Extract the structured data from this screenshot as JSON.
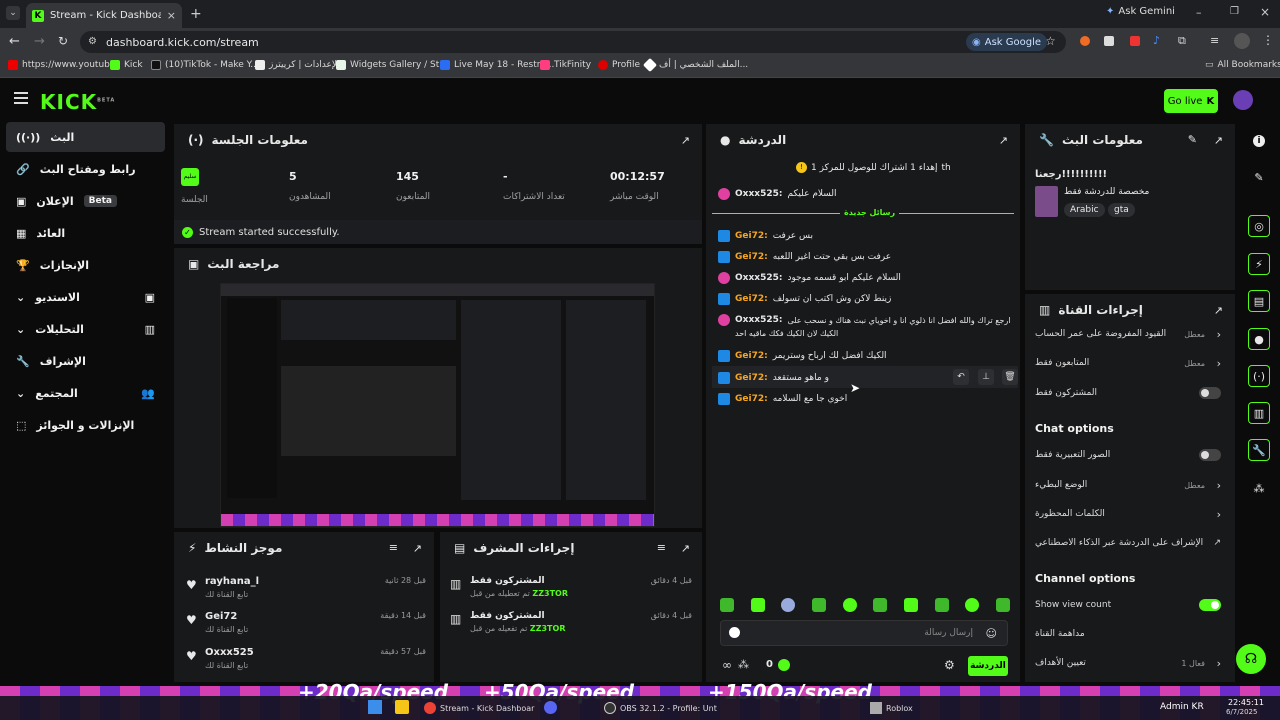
{
  "browser": {
    "tab_title": "Stream - Kick Dashboard",
    "ask_gemini": "Ask Gemini",
    "url": "dashboard.kick.com/stream",
    "ask_google": "Ask Google",
    "bookmarks": [
      "https://www.youtub...",
      "Kick",
      "(10)TikTok - Make Y...",
      "الإعدادات | كرييترز",
      "Widgets Gallery / St...",
      "Live May 18 - Restre...",
      "TikFinity",
      "Profile",
      "الملف الشخصي | أف..."
    ],
    "all_bookmarks": "All Bookmarks"
  },
  "kick": {
    "logo": "KICK",
    "beta": "BETA",
    "go_live": "Go live"
  },
  "sidebar": {
    "items": [
      {
        "label": "البث",
        "icon": "broadcast-icon"
      },
      {
        "label": "رابط ومفتاح البث",
        "icon": "link-icon"
      },
      {
        "label": "الإعلان",
        "icon": "ad-icon",
        "badge": "Beta"
      },
      {
        "label": "العائد",
        "icon": "chart-icon"
      },
      {
        "label": "الإنجازات",
        "icon": "trophy-icon"
      },
      {
        "label": "الاستديو",
        "icon": "studio-icon"
      },
      {
        "label": "التحليلات",
        "icon": "analytics-icon"
      },
      {
        "label": "الإشراف",
        "icon": "wrench-icon"
      },
      {
        "label": "المجتمع",
        "icon": "community-icon"
      },
      {
        "label": "الإنزالات و الجوائز",
        "icon": "drops-icon"
      }
    ]
  },
  "session": {
    "title": "معلومات الجلسة",
    "live_badge": "سليم",
    "live_label": "الجلسة",
    "viewers_value": "5",
    "viewers_label": "المشاهدون",
    "followers_value": "145",
    "followers_label": "المتابعون",
    "subs_value": "-",
    "subs_label": "تعداد الاشتراكات",
    "time_value": "00:12:57",
    "time_label": "الوقت مباشر",
    "status": "Stream started successfully."
  },
  "preview": {
    "title": "مراجعة البث"
  },
  "chat": {
    "title": "الدردشة",
    "goal": "إهداء 1 اشتراك للوصول للمركز 1",
    "goal_suffix": "th",
    "first": {
      "user": "Oxxx525:",
      "text": "السلام عليكم"
    },
    "new_messages": "رسائل جديدة",
    "messages": [
      {
        "user": "Gei72:",
        "text": "بس عرفت",
        "type": "k"
      },
      {
        "user": "Gei72:",
        "text": "عرفت بس بقي حتت اغير اللعبه",
        "type": "k"
      },
      {
        "user": "Oxxx525:",
        "text": "السلام عليكم ابو قسمه موجود",
        "type": "o"
      },
      {
        "user": "Gei72:",
        "text": "زينط لاكن وش اكتب ان تسولف",
        "type": "k"
      },
      {
        "user": "Oxxx525:",
        "text": "ارجع تراك والله افضل انا ذلوي انا و اخوياي نبث هناك و نسحب على",
        "type": "o"
      },
      {
        "user": "",
        "text": "الكيك لان الكيك فكك ماقيه احد",
        "type": "none"
      },
      {
        "user": "Gei72:",
        "text": "الكيك افضل لك ارباح وستريمر",
        "type": "k"
      },
      {
        "user": "Gei72:",
        "text": "و ماهو مستقعد",
        "type": "k"
      },
      {
        "user": "Gei72:",
        "text": "اخوي جا مع السلامه",
        "type": "k"
      }
    ],
    "input_placeholder": "إرسال رسالة",
    "points": "0",
    "send_label": "الدردشة"
  },
  "activity": {
    "title": "موجز النشاط",
    "rows": [
      {
        "name": "rayhana_l",
        "sub": "تابع القناة لك",
        "time": "قبل 28 ثانية"
      },
      {
        "name": "Gei72",
        "sub": "تابع القناة لك",
        "time": "قبل 14 دقيقة"
      },
      {
        "name": "Oxxx525",
        "sub": "تابع القناة لك",
        "time": "قبل 57 دقيقة"
      }
    ]
  },
  "mod": {
    "title": "إجراءات المشرف",
    "rows": [
      {
        "title": "المشتركون فقط",
        "sub": "تم تعطيله من قبل",
        "who": "ZZ3TOR",
        "time": "قبل 4 دقائق"
      },
      {
        "title": "المشتركون فقط",
        "sub": "تم تفعيله من قبل",
        "who": "ZZ3TOR",
        "time": "قبل 4 دقائق"
      }
    ]
  },
  "stream_info": {
    "title": "معلومات البث",
    "stream_title": "رجعنا!!!!!!!!!!",
    "category": "مخصصة للدردشة فقط",
    "tags": [
      "Arabic",
      "gta"
    ]
  },
  "channel_actions": {
    "title": "إجراءات القناة",
    "rows": [
      {
        "label": "القيود المفروضة على عمر الحساب",
        "value": "معطل",
        "kind": "chev"
      },
      {
        "label": "المتابعون فقط",
        "value": "معطل",
        "kind": "chev"
      },
      {
        "label": "المشتركون فقط",
        "value": "",
        "kind": "toggle-off"
      }
    ],
    "chat_options": "Chat options",
    "chat_rows": [
      {
        "label": "الصور التعبيرية فقط",
        "value": "",
        "kind": "toggle-off"
      },
      {
        "label": "الوضع البطيء",
        "value": "معطل",
        "kind": "chev"
      },
      {
        "label": "الكلمات المحظورة",
        "value": "",
        "kind": "chev"
      },
      {
        "label": "الإشراف على الدردشة عبر الذكاء الاصطناعي",
        "value": "",
        "kind": "ext"
      }
    ],
    "channel_options": "Channel options",
    "channel_rows": [
      {
        "label": "Show view count",
        "value": "",
        "kind": "toggle-on"
      },
      {
        "label": "مداهمة القناة",
        "value": "",
        "kind": "none"
      },
      {
        "label": "تعيين الأهداف",
        "value": "فعال 1",
        "kind": "chev"
      }
    ]
  },
  "overlay": {
    "texts": [
      "+20Qa/speed",
      "+50Qa/speed",
      "+150Qa/speed"
    ]
  },
  "taskbar": {
    "items": [
      "Stream - Kick Dashboar",
      "OBS 32.1.2 - Profile: Unt",
      "Roblox"
    ],
    "user": "Admin KR",
    "time": "22:45:11",
    "date": "6/7/2025"
  },
  "colors": {
    "accent": "#53fc18",
    "panel": "#18191b",
    "bg": "#0b0b0c"
  }
}
